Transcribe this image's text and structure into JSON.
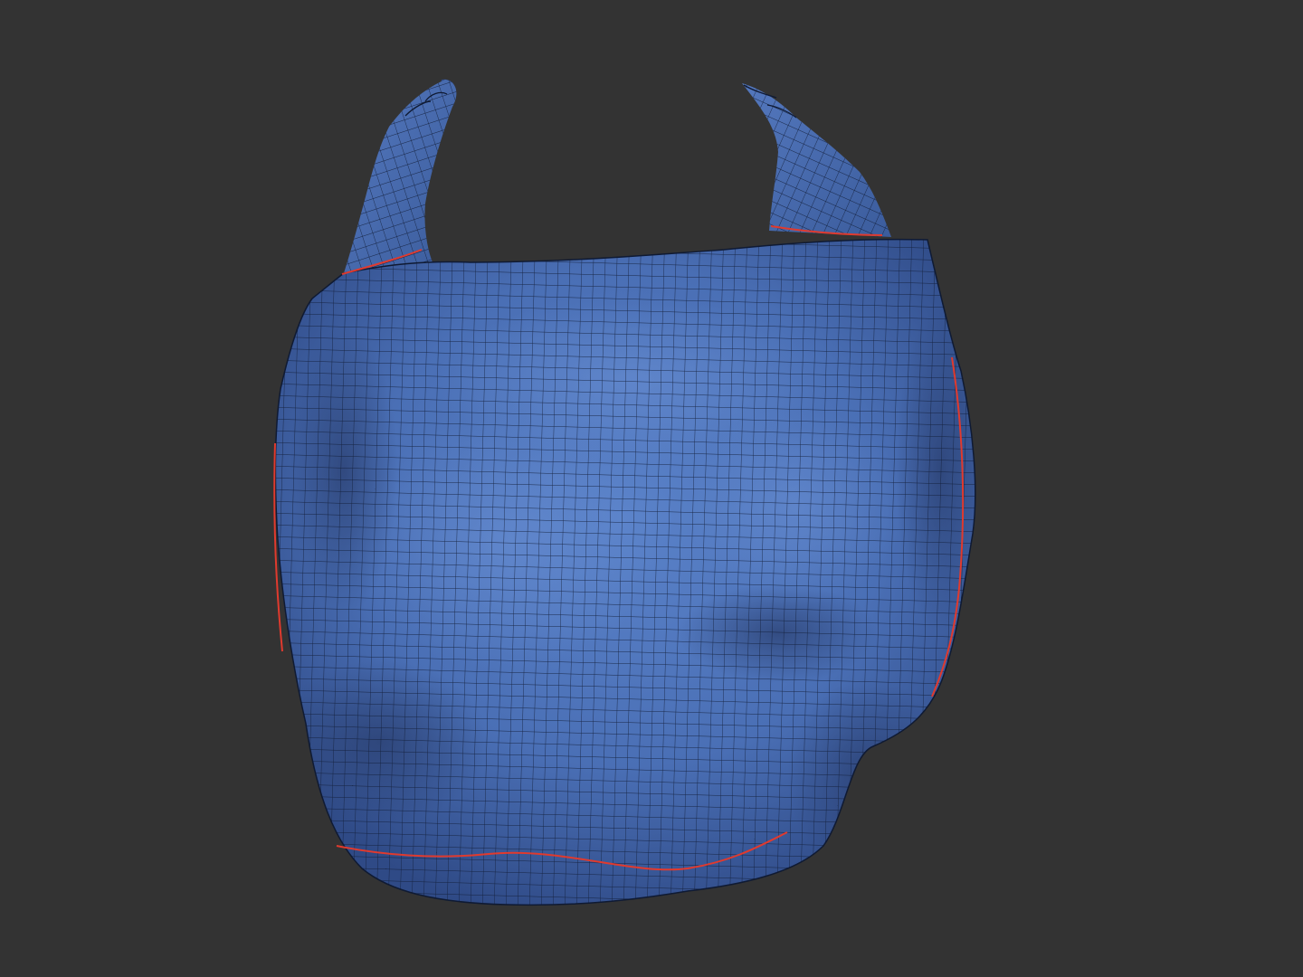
{
  "viewport": {
    "background": "#333333",
    "view_mode": "wireframe-on-shaded",
    "grid": false
  },
  "object": {
    "type": "plastic-bag-mesh",
    "name": "",
    "surface_color": "#4a6fb5",
    "surface_highlight": "#5a82c9",
    "surface_shadow": "#2a3f70",
    "wire_color": "#0f1a33",
    "seam_color": "#e03a2e"
  }
}
